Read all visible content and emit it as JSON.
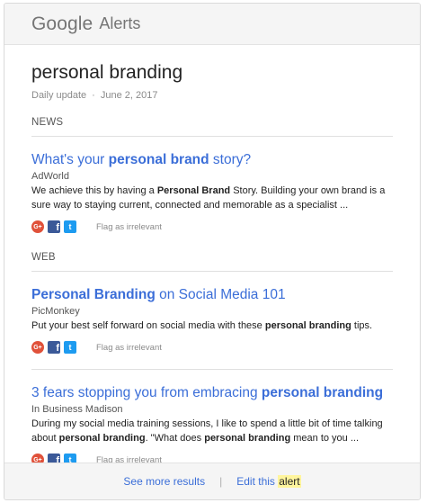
{
  "header": {
    "brand_google": "Google",
    "brand_alerts": "Alerts"
  },
  "alert": {
    "title": "personal branding",
    "frequency": "Daily update",
    "separator": "·",
    "date": "June 2, 2017"
  },
  "news": {
    "label": "NEWS",
    "items": [
      {
        "title": [
          {
            "t": "What's your ",
            "b": false
          },
          {
            "t": "personal brand",
            "b": true
          },
          {
            "t": " story?",
            "b": false
          }
        ],
        "source": "AdWorld",
        "snippet": [
          {
            "t": "We achieve this by having a ",
            "b": false
          },
          {
            "t": "Personal Brand",
            "b": true
          },
          {
            "t": " Story. Building your own brand is a sure way to staying current, connected and memorable as a specialist ...",
            "b": false
          }
        ],
        "flag_label": "Flag as irrelevant"
      }
    ]
  },
  "web": {
    "label": "WEB",
    "items": [
      {
        "title": [
          {
            "t": "Personal Branding",
            "b": true
          },
          {
            "t": " on Social Media 101",
            "b": false
          }
        ],
        "source": "PicMonkey",
        "snippet": [
          {
            "t": "Put your best self forward on social media with these ",
            "b": false
          },
          {
            "t": "personal branding",
            "b": true
          },
          {
            "t": " tips.",
            "b": false
          }
        ],
        "flag_label": "Flag as irrelevant"
      },
      {
        "title": [
          {
            "t": "3 fears stopping you from embracing ",
            "b": false
          },
          {
            "t": "personal branding",
            "b": true
          }
        ],
        "source": "In Business Madison",
        "snippet": [
          {
            "t": "During my social media training sessions, I like to spend a little bit of time talking about ",
            "b": false
          },
          {
            "t": "personal branding",
            "b": true
          },
          {
            "t": ". \"What does ",
            "b": false
          },
          {
            "t": "personal branding",
            "b": true
          },
          {
            "t": " mean to you ...",
            "b": false
          }
        ],
        "flag_label": "Flag as irrelevant"
      }
    ]
  },
  "social_icons": [
    {
      "name": "google-plus-icon",
      "glyph": "G+",
      "color": "#e0513a"
    },
    {
      "name": "facebook-icon",
      "glyph": "f",
      "color": "#3b5998"
    },
    {
      "name": "twitter-icon",
      "glyph": "t",
      "color": "#1d9bf0"
    }
  ],
  "footer": {
    "see_more": "See more results",
    "divider": "|",
    "edit_prefix": "Edit this ",
    "edit_highlight": "alert"
  },
  "colors": {
    "link": "#3b6ed8",
    "highlight": "#fff59d"
  }
}
